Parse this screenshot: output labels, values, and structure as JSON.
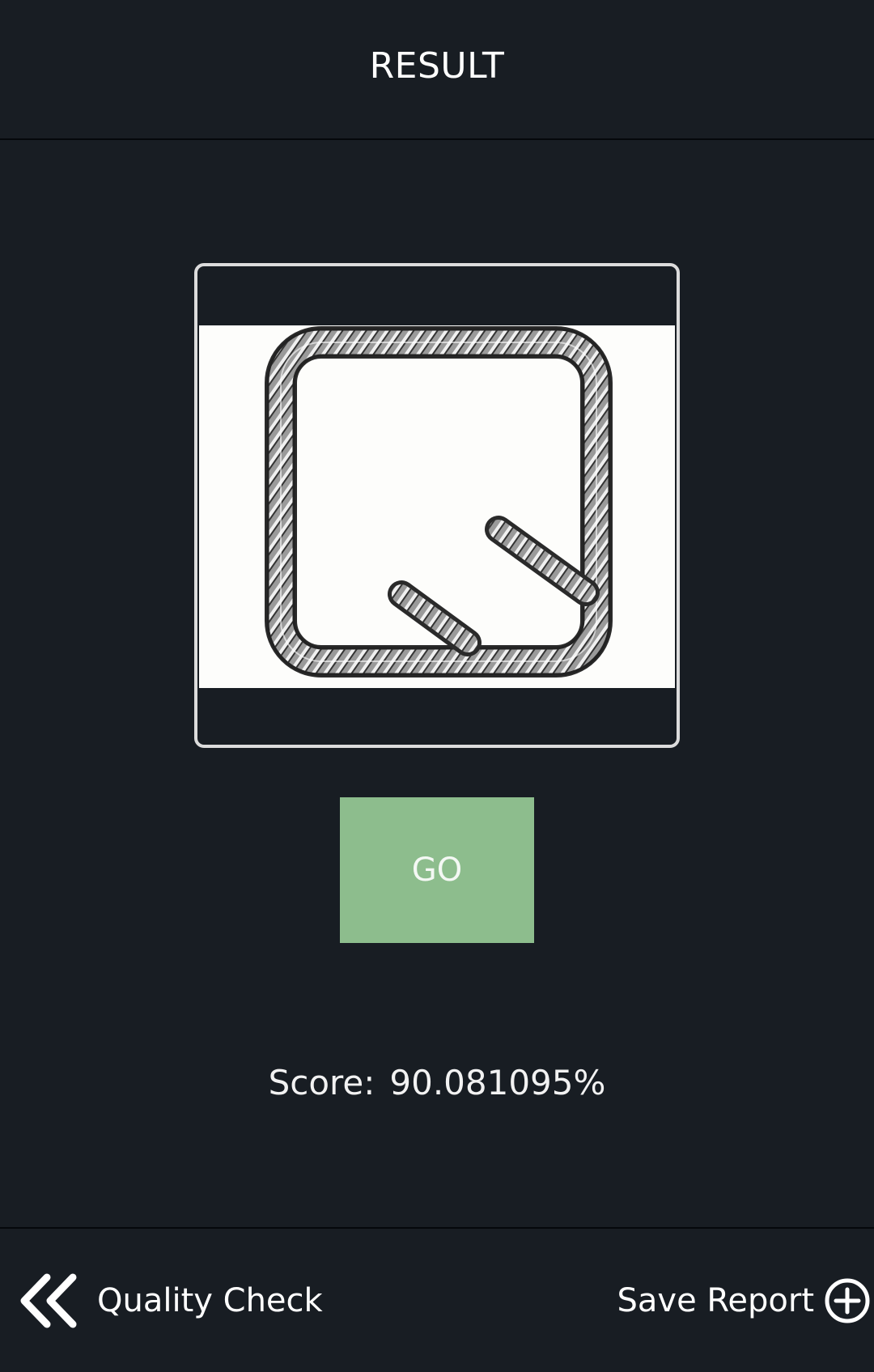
{
  "header": {
    "title": "RESULT"
  },
  "image": {
    "subject": "rebar-stirrup-image",
    "background": "#fdfdfb"
  },
  "go_button": {
    "label": "GO",
    "color": "#8dbd8d"
  },
  "score": {
    "label": "Score:",
    "value": "90.081095%"
  },
  "footer": {
    "back": {
      "label": "Quality Check",
      "icon": "double-chevron-left-icon"
    },
    "save": {
      "label": "Save Report",
      "icon": "plus-circle-icon"
    }
  },
  "colors": {
    "background": "#181d23",
    "divider": "#05080b",
    "frame_border": "#dcdcdc",
    "text": "#ffffff"
  }
}
